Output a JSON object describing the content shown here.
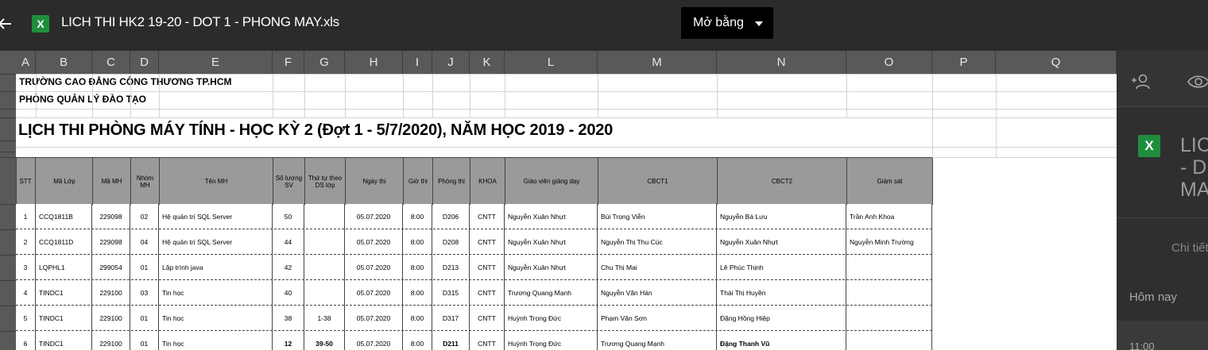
{
  "topbar": {
    "filename": "LICH THI HK2 19-20 - DOT 1 - PHONG MAY.xls",
    "file_icon_letter": "X",
    "open_with_label": "Mở bằng"
  },
  "sheet": {
    "columns": [
      "A",
      "B",
      "C",
      "D",
      "E",
      "F",
      "G",
      "H",
      "I",
      "J",
      "K",
      "L",
      "M",
      "N",
      "O",
      "P",
      "Q"
    ],
    "school": "TRƯỜNG CAO ĐẲNG CÔNG THƯƠNG TP.HCM",
    "department": "PHÒNG QUẢN LÝ ĐÀO TẠO",
    "title": "LỊCH THI PHÒNG MÁY TÍNH - HỌC KỲ 2 (Đợt 1 - 5/7/2020), NĂM HỌC 2019 - 2020",
    "headers": [
      "STT",
      "Mã Lớp",
      "Mã MH",
      "Nhóm MH",
      "Tên MH",
      "Số lượng SV",
      "Thứ tự theo DS lớp",
      "Ngày thi",
      "Giờ thi",
      "Phòng thi",
      "KHOA",
      "Giáo viên giảng dạy",
      "CBCT1",
      "CBCT2",
      "Giám sát"
    ],
    "rows": [
      [
        "1",
        "CCQ1811B",
        "229098",
        "02",
        "Hệ quản trị SQL Server",
        "50",
        "",
        "05.07.2020",
        "8:00",
        "D206",
        "CNTT",
        "Nguyễn Xuân Nhựt",
        "Bùi Trọng Viễn",
        "Nguyễn Bá Lưu",
        "Trần Anh Khoa"
      ],
      [
        "2",
        "CCQ1811D",
        "229098",
        "04",
        "Hệ quản trị SQL Server",
        "44",
        "",
        "05.07.2020",
        "8:00",
        "D208",
        "CNTT",
        "Nguyễn Xuân Nhựt",
        "Nguyễn Thị Thu Cúc",
        "Nguyễn Xuân Nhựt",
        "Nguyễn Minh Trường"
      ],
      [
        "3",
        "LQPHL1",
        "299054",
        "01",
        "Lập trình java",
        "42",
        "",
        "05.07.2020",
        "8:00",
        "D213",
        "CNTT",
        "Nguyễn Xuân Nhựt",
        "Chu Thị Mai",
        "Lê Phúc Thịnh",
        ""
      ],
      [
        "4",
        "TINDC1",
        "229100",
        "03",
        "Tin học",
        "40",
        "",
        "05.07.2020",
        "8:00",
        "D315",
        "CNTT",
        "Trương Quang Mạnh",
        "Nguyễn Văn Hán",
        "Thái Thị Huyền",
        ""
      ],
      [
        "5",
        "TINDC1",
        "229100",
        "01",
        "Tin học",
        "38",
        "1-38",
        "05.07.2020",
        "8:00",
        "D317",
        "CNTT",
        "Huỳnh Trọng Đức",
        "Phạm Văn Sơn",
        "Đặng Hồng Hiệp",
        ""
      ],
      [
        "6",
        "TINDC1",
        "229100",
        "01",
        "Tin học",
        "12",
        "39-50",
        "05.07.2020",
        "8:00",
        "D211",
        "CNTT",
        "Huỳnh Trọng Đức",
        "Trương Quang Mạnh",
        "Đặng Thanh Vũ",
        ""
      ]
    ]
  },
  "panel": {
    "file_icon_letter": "X",
    "title": "LIC\n- D\nMA",
    "details_label": "Chi tiết",
    "today_label": "Hôm nay",
    "time_label": "11:00"
  }
}
